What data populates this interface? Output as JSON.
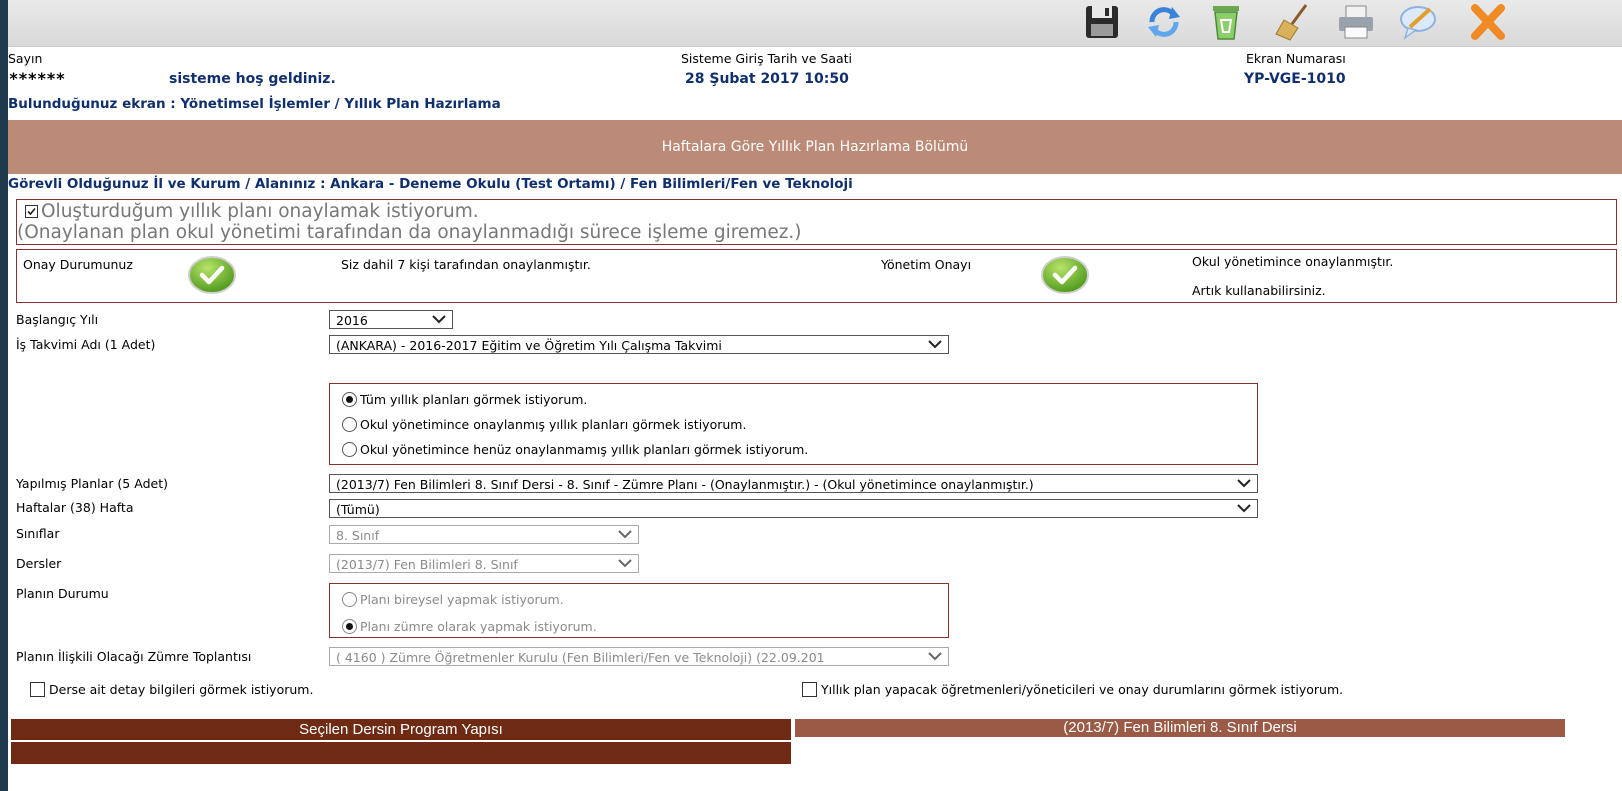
{
  "header": {
    "sayin_label": "Sayın",
    "user_masked": "*******",
    "welcome": "sisteme hoş geldiniz.",
    "login_label": "Sisteme Giriş Tarih ve Saati",
    "login_value": "28 Şubat 2017 10:50",
    "screen_label": "Ekran Numarası",
    "screen_value": "YP-VGE-1010",
    "breadcrumb": "Bulunduğunuz ekran : Yönetimsel İşlemler / Yıllık Plan Hazırlama"
  },
  "toolbar": {
    "icons": [
      "save-icon",
      "refresh-icon",
      "recycle-bin-icon",
      "broom-icon",
      "printer-icon",
      "comment-icon",
      "close-icon"
    ]
  },
  "section_title": "Haftalara Göre Yıllık Plan Hazırlama Bölümü",
  "institution_line": "Görevli Olduğunuz İl ve Kurum / Alanınız : Ankara - Deneme Okulu (Test Ortamı) / Fen Bilimleri/Fen ve Teknoloji",
  "approve": {
    "line1": "Oluşturduğum yıllık planı onaylamak istiyorum.",
    "line2": "(Onaylanan plan okul yönetimi tarafından da onaylanmadığı sürece işleme giremez.)",
    "checked": true
  },
  "status": {
    "onay_label": "Onay Durumunuz",
    "onay_text": "Siz dahil 7 kişi tarafından onaylanmıştır.",
    "yonetim_label": "Yönetim Onayı",
    "yonetim_text1": "Okul yönetimince onaylanmıştır.",
    "yonetim_text2": "Artık kullanabilirsiniz."
  },
  "form": {
    "baslangic_label": "Başlangıç Yılı",
    "baslangic_value": "2016",
    "takvim_label": "İş Takvimi Adı (1 Adet)",
    "takvim_value": "(ANKARA) - 2016-2017 Eğitim ve Öğretim Yılı Çalışma Takvimi",
    "view_options": [
      "Tüm yıllık planları görmek istiyorum.",
      "Okul yönetimince onaylanmış yıllık planları görmek istiyorum.",
      "Okul yönetimince henüz onaylanmamış yıllık planları görmek istiyorum."
    ],
    "view_selected_index": 0,
    "planlar_label": "Yapılmış Planlar (5 Adet)",
    "planlar_value": "(2013/7) Fen Bilimleri 8. Sınıf Dersi - 8. Sınıf - Zümre Planı - (Onaylanmıştır.) - (Okul yönetimince onaylanmıştır.)",
    "haftalar_label": "Haftalar (38) Hafta",
    "haftalar_value": "(Tümü)",
    "siniflar_label": "Sınıflar",
    "siniflar_value": "8. Sınıf",
    "dersler_label": "Dersler",
    "dersler_value": "(2013/7) Fen Bilimleri 8. Sınıf",
    "durum_label": "Planın Durumu",
    "durum_options": [
      "Planı bireysel yapmak istiyorum.",
      "Planı zümre olarak yapmak istiyorum."
    ],
    "durum_selected_index": 1,
    "zumre_label": "Planın İlişkili Olacağı Zümre Toplantısı",
    "zumre_value": "( 4160 ) Zümre Öğretmenler Kurulu (Fen Bilimleri/Fen ve Teknoloji) (22.09.201"
  },
  "checkboxes": {
    "detay": "Derse ait detay bilgileri görmek istiyorum.",
    "ogretmenler": "Yıllık plan yapacak öğretmenleri/yöneticileri ve onay durumlarını görmek istiyorum."
  },
  "bars": {
    "left_title": "Seçilen Dersin Program Yapısı",
    "right_title": "(2013/7) Fen Bilimleri 8. Sınıf Dersi"
  },
  "colors": {
    "section_band": "#bb8b77",
    "dark_bar": "#6e2a12",
    "right_bar": "#9a5a45",
    "heading_blue": "#0f2f6e",
    "box_border": "#8c2f2f",
    "ok_green": "#6fbb2a"
  }
}
